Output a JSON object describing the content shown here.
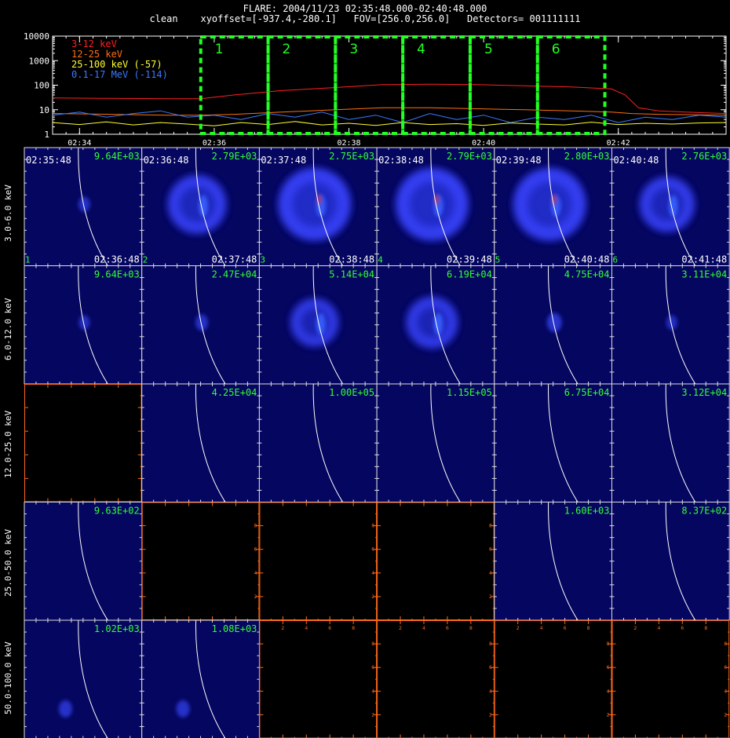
{
  "header": {
    "title": "FLARE: 2004/11/23 02:35:48.000-02:40:48.000",
    "subtitle": "clean    xyoffset=[-937.4,-280.1]   FOV=[256.0,256.0]   Detectors= 001111111"
  },
  "chart_data": [
    {
      "type": "line",
      "id": "lightcurve",
      "xlabel": "",
      "ylabel": "",
      "yscale": "log",
      "ylim": [
        1,
        10000
      ],
      "y_ticks": [
        "1",
        "10",
        "100",
        "1000",
        "10000"
      ],
      "x_ticks": [
        "02:34",
        "02:36",
        "02:38",
        "02:40",
        "02:42"
      ],
      "x_tick_minutes": [
        34,
        36,
        38,
        40,
        42
      ],
      "xlim_minutes": [
        33.6,
        43.6
      ],
      "legend_position": "top-left",
      "series": [
        {
          "name": "3-12 keV",
          "color": "#ff2020",
          "x": [
            33.6,
            34.5,
            35.3,
            35.8,
            36.3,
            37.0,
            37.8,
            38.5,
            39.2,
            39.9,
            40.6,
            41.3,
            41.9,
            42.1,
            42.3,
            42.6,
            43.0,
            43.6
          ],
          "y": [
            30,
            29,
            28,
            28,
            40,
            60,
            80,
            105,
            110,
            105,
            95,
            85,
            70,
            40,
            12,
            9,
            8,
            7
          ]
        },
        {
          "name": "12-25 keV",
          "color": "#ff7010",
          "x": [
            33.6,
            34.5,
            35.3,
            35.8,
            36.3,
            37.0,
            37.8,
            38.5,
            39.2,
            39.9,
            40.6,
            41.3,
            41.9,
            42.2,
            42.6,
            43.6
          ],
          "y": [
            7,
            6.5,
            6,
            6,
            6.5,
            8,
            10,
            12,
            12,
            11,
            10,
            9,
            8,
            7,
            6.5,
            6
          ]
        },
        {
          "name": "25-100 keV (-57)",
          "color": "#ffff30",
          "x": [
            33.6,
            34.0,
            34.4,
            34.8,
            35.2,
            35.6,
            36.0,
            36.4,
            36.8,
            37.2,
            37.6,
            38.0,
            38.4,
            38.8,
            39.2,
            39.6,
            40.0,
            40.4,
            40.8,
            41.2,
            41.6,
            42.0,
            42.4,
            42.8,
            43.2,
            43.6
          ],
          "y": [
            3,
            2.5,
            3.2,
            2.4,
            3,
            2.6,
            2.2,
            3,
            2.5,
            3.3,
            2.4,
            2.8,
            2.3,
            3,
            2.5,
            2.7,
            2.3,
            2.9,
            2.6,
            2.4,
            3.1,
            2.5,
            2.8,
            2.6,
            2.9,
            3
          ]
        },
        {
          "name": "0.1-17 MeV (-114)",
          "color": "#3a7aff",
          "x": [
            33.6,
            34.0,
            34.4,
            34.8,
            35.2,
            35.6,
            36.0,
            36.4,
            36.8,
            37.2,
            37.6,
            38.0,
            38.4,
            38.8,
            39.2,
            39.6,
            40.0,
            40.4,
            40.8,
            41.2,
            41.6,
            42.0,
            42.4,
            42.8,
            43.2,
            43.6
          ],
          "y": [
            6,
            8,
            5,
            7,
            9,
            5,
            6,
            4,
            7,
            5,
            8,
            4,
            6,
            3,
            7,
            4,
            6,
            3,
            5,
            4,
            6,
            3,
            5,
            4,
            6,
            5
          ]
        }
      ],
      "boxes": [
        {
          "label": "1",
          "x0": 35.8,
          "x1": 36.8
        },
        {
          "label": "2",
          "x0": 36.8,
          "x1": 37.8
        },
        {
          "label": "3",
          "x0": 37.8,
          "x1": 38.8
        },
        {
          "label": "4",
          "x0": 38.8,
          "x1": 39.8
        },
        {
          "label": "5",
          "x0": 39.8,
          "x1": 40.8
        },
        {
          "label": "6",
          "x0": 40.8,
          "x1": 41.8
        }
      ]
    },
    {
      "type": "heatmap",
      "id": "image-grid",
      "energy_bands": [
        "3.0-6.0 keV",
        "6.0-12.0 keV",
        "12.0-25.0 keV",
        "25.0-50.0 keV",
        "50.0-100.0 keV"
      ],
      "time_start_labels": [
        "02:35:48",
        "02:36:48",
        "02:37:48",
        "02:38:48",
        "02:39:48",
        "02:40:48"
      ],
      "time_end_labels": [
        "02:36:48",
        "02:37:48",
        "02:38:48",
        "02:39:48",
        "02:40:48",
        "02:41:48"
      ],
      "interval_labels": [
        "1",
        "2",
        "3",
        "4",
        "5",
        "6"
      ],
      "max_values": [
        [
          "9.64E+03",
          "2.79E+03",
          "2.75E+03",
          "2.79E+03",
          "2.80E+03",
          "2.76E+03"
        ],
        [
          "9.64E+03",
          "2.47E+04",
          "5.14E+04",
          "6.19E+04",
          "4.75E+04",
          "3.11E+04"
        ],
        [
          "",
          "4.25E+04",
          "1.00E+05",
          "1.15E+05",
          "6.75E+04",
          "3.12E+04"
        ],
        [
          "9.63E+02",
          "",
          "",
          "",
          "1.60E+03",
          "8.37E+02"
        ],
        [
          "1.02E+03",
          "1.08E+03",
          "",
          "",
          "",
          ""
        ]
      ],
      "cell_state": [
        [
          "image",
          "image",
          "image",
          "image",
          "image",
          "image"
        ],
        [
          "image",
          "image",
          "image",
          "image",
          "image",
          "image"
        ],
        [
          "empty",
          "image",
          "image",
          "image",
          "image",
          "image"
        ],
        [
          "image",
          "empty",
          "empty",
          "empty",
          "image",
          "image"
        ],
        [
          "image",
          "image",
          "empty",
          "empty",
          "empty",
          "empty"
        ]
      ],
      "source_intensity": [
        [
          0.15,
          0.8,
          1.0,
          1.0,
          1.0,
          0.75
        ],
        [
          0.1,
          0.2,
          0.65,
          0.7,
          0.35,
          0.1
        ],
        [
          0,
          0,
          0,
          0,
          0,
          0
        ],
        [
          0,
          0,
          0,
          0,
          0,
          0
        ],
        [
          0.25,
          0.25,
          0,
          0,
          0,
          0
        ]
      ],
      "empty_axis_ticks": [
        "2",
        "4",
        "6",
        "8"
      ],
      "colors": {
        "background": "#000000",
        "image_bg": "#050660",
        "empty_axis": "#ff6a1a",
        "max_label": "#33ff33",
        "limb": "#ffffff",
        "box": "#22ff22"
      }
    }
  ]
}
